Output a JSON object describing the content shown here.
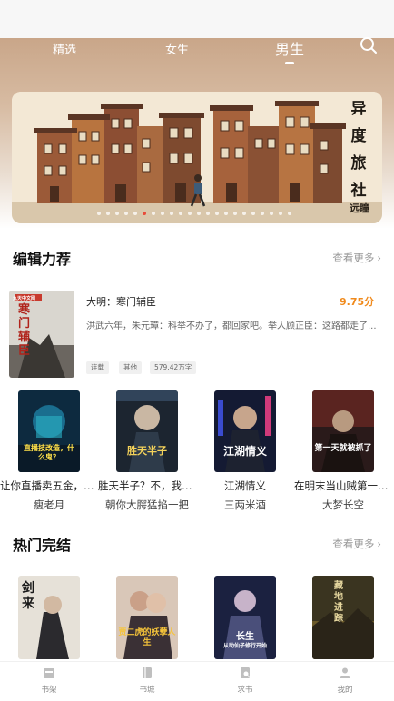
{
  "top_tabs": [
    {
      "label": "精选"
    },
    {
      "label": "女生"
    },
    {
      "label": "男生"
    }
  ],
  "banner": {
    "title_chars": [
      "异",
      "度",
      "旅",
      "社"
    ],
    "subtitle": "远瞳"
  },
  "editor_picks": {
    "title": "编辑力荐",
    "more": "查看更多",
    "featured": {
      "title": "大明：寒门辅臣",
      "score": "9.75分",
      "description": "洪武六年，朱元璋：科举不办了，都回家吧。举人顾正臣：这路都走了...",
      "tags": [
        "连载",
        "其他",
        "579.42万字"
      ],
      "cover_title": "寒门辅臣",
      "cover_badge": "九天中文网"
    },
    "books": [
      {
        "title": "让你直播卖五金，你怎么搞...",
        "author": "瘦老月",
        "cover_text": "直播技改造，什么鬼？"
      },
      {
        "title": "胜天半子？不，我要你满盘...",
        "author": "朝你大腭猛掐一把",
        "cover_text": "胜天半子"
      },
      {
        "title": "江湖情义",
        "author": "三两米酒",
        "cover_text": "江湖情义"
      },
      {
        "title": "在明末当山贼第一天就被...",
        "author": "大梦长空",
        "cover_text": "第一天就被抓了"
      }
    ]
  },
  "hot_complete": {
    "title": "热门完结",
    "more": "查看更多",
    "books": [
      {
        "cover_text": "剑来"
      },
      {
        "cover_text": "贾二虎的妖孽人生"
      },
      {
        "cover_text": "长生",
        "cover_sub": "从助仙子修行开始"
      },
      {
        "cover_text": "藏地进踪"
      }
    ]
  },
  "bottom_nav": [
    {
      "label": "书架",
      "icon": "bookshelf-icon"
    },
    {
      "label": "书城",
      "icon": "bookstore-icon"
    },
    {
      "label": "求书",
      "icon": "request-book-icon"
    },
    {
      "label": "我的",
      "icon": "profile-icon"
    }
  ],
  "colors": {
    "accent": "#f08a1c",
    "active_dot": "#e84b3a",
    "header": "#c9a689"
  }
}
